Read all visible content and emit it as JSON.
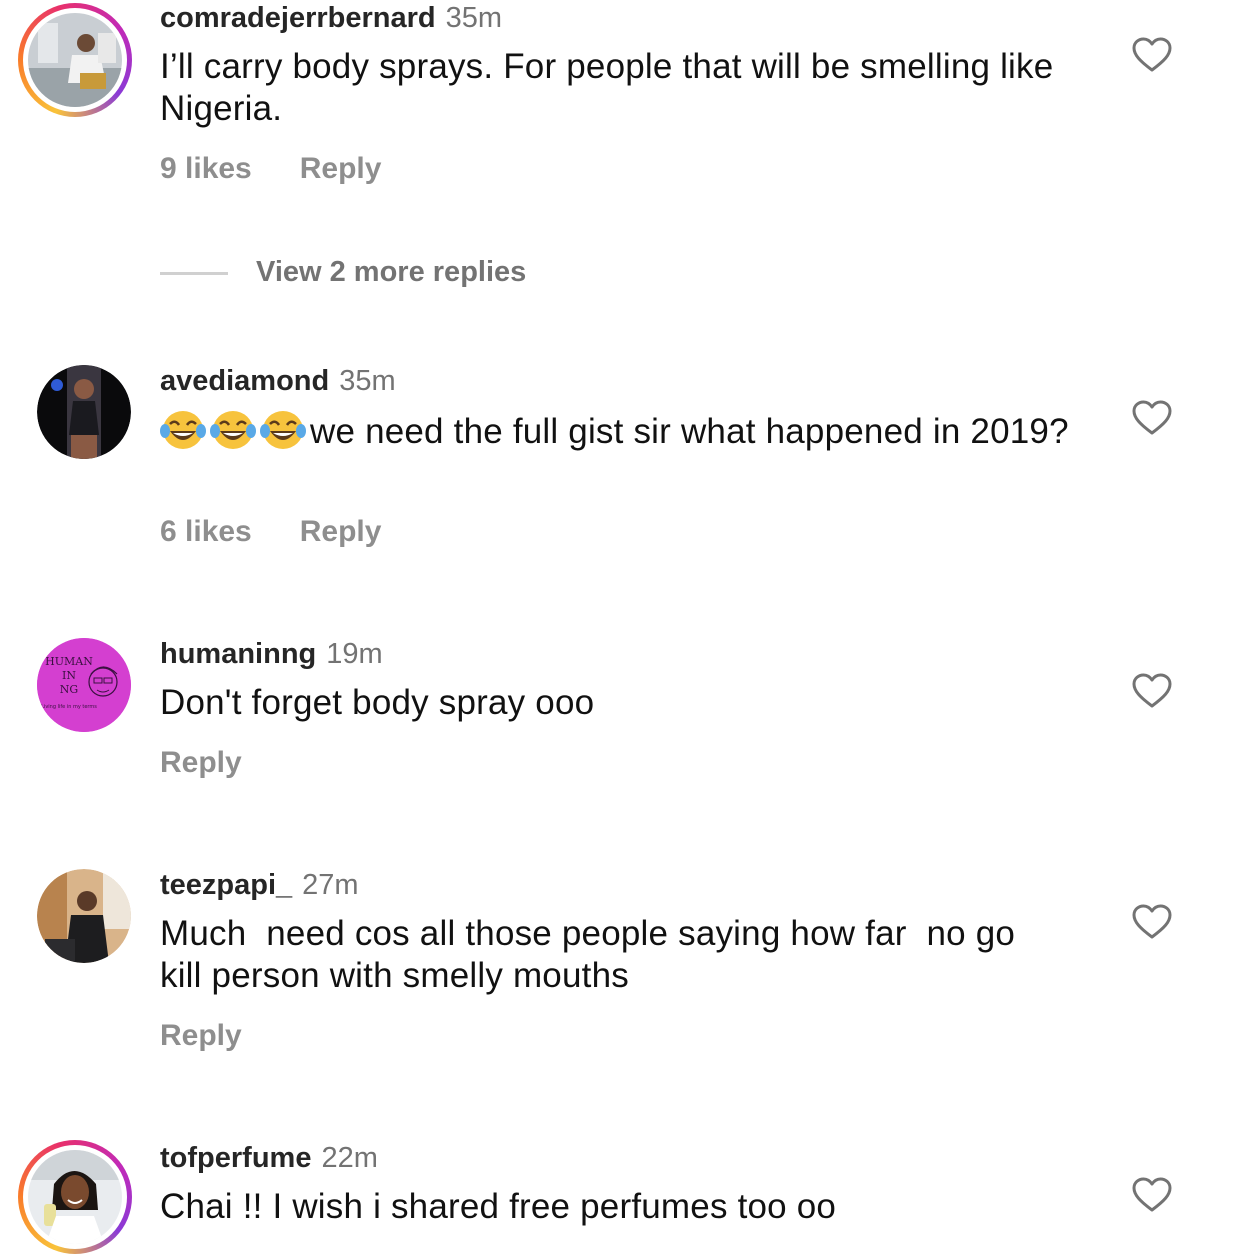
{
  "comments": [
    {
      "username": "comradejerrbernard",
      "time": "35m",
      "text": "I’ll carry body sprays. For people that will be smelling like Nigeria.",
      "likes": "9 likes",
      "reply": "Reply",
      "view_more": "View 2 more replies"
    },
    {
      "username": "avediamond",
      "time": "35m",
      "emoji_prefix": [
        "laughing-tears-emoji",
        "laughing-tears-emoji",
        "laughing-tears-emoji"
      ],
      "text": "we need the full gist sir what happened in 2019?",
      "likes": "6 likes",
      "reply": "Reply"
    },
    {
      "username": "humaninng",
      "time": "19m",
      "text": "Don't forget body spray ooo",
      "reply": "Reply",
      "avatar_text": [
        "HUMAN",
        "IN",
        "NG",
        "Living life in my terms"
      ]
    },
    {
      "username": "teezpapi_",
      "time": "27m",
      "text": "Much  need cos all those people saying how far  no go kill person with smelly mouths",
      "reply": "Reply"
    },
    {
      "username": "tofperfume",
      "time": "22m",
      "text": "Chai !! I wish i shared free perfumes too oo"
    }
  ],
  "colors": {
    "text": "#111111",
    "username": "#262626",
    "muted": "#8e8e8e",
    "humaninng_avatar": "#d43fd0"
  },
  "icons": [
    "heart-outline-icon",
    "laughing-tears-emoji"
  ]
}
